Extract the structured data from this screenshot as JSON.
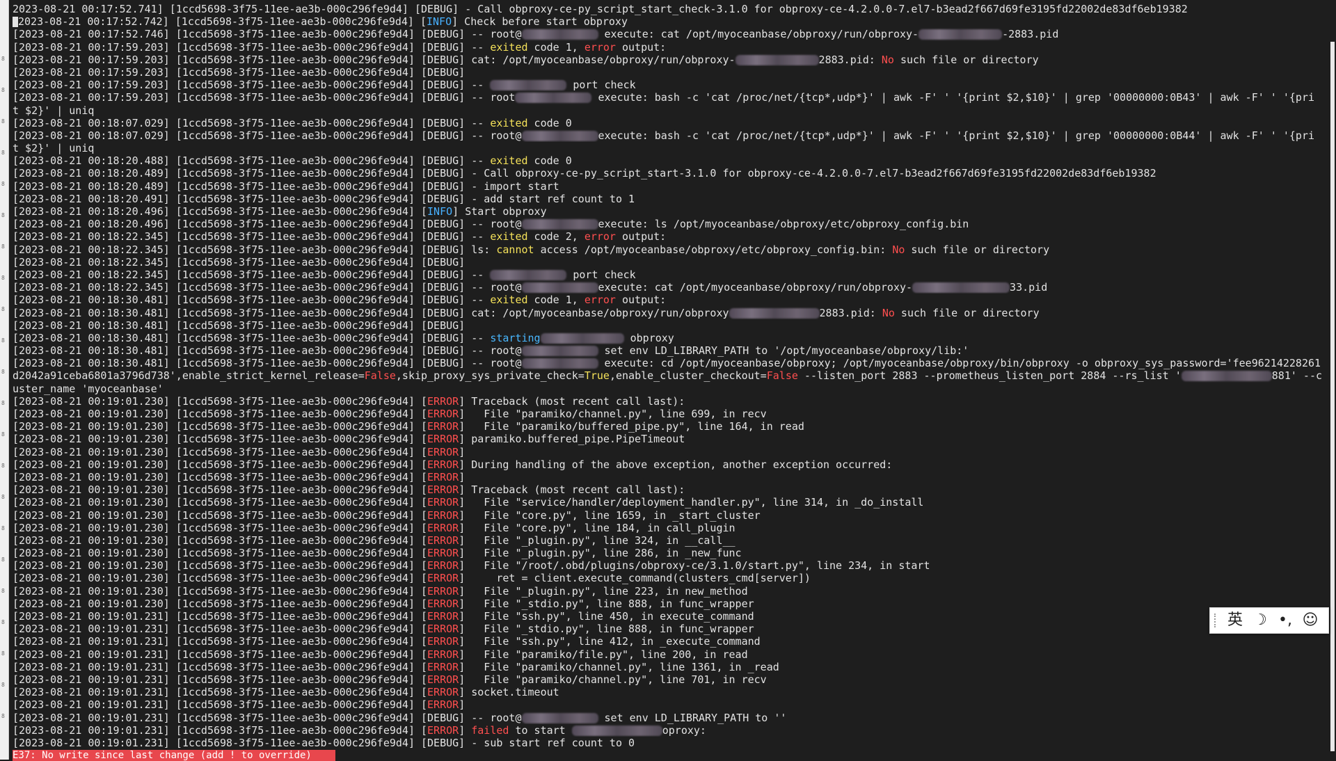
{
  "gutter": [
    "8",
    "8",
    "8",
    "8",
    "8",
    "8",
    "8",
    "8",
    "8",
    "8",
    "8",
    "8",
    "8",
    "8",
    "8",
    "8",
    "8",
    "8",
    "8",
    "8",
    "8",
    "8"
  ],
  "lines": [
    [
      [
        "2023-08-21 00:17:52.741",
        "t"
      ],
      [
        "] [",
        "t"
      ],
      [
        "1ccd5698-3f75-11ee-ae3b-000c296fe9d4",
        "t"
      ],
      [
        "] [DEBUG] - Call obproxy-ce-py_script_start_check-3.1.0 for obproxy-ce-4.2.0.0-7.el7-b3ead2f667d69fe3195fd22002de83df6eb19382",
        "t"
      ]
    ],
    [
      [
        "[2023-08-21 00:17:52.742] [1ccd5698-3f75-11ee-ae3b-000c296fe9d4] [",
        "t"
      ],
      [
        "INFO",
        "inf"
      ],
      [
        "] Check before start obproxy",
        "t"
      ]
    ],
    [
      [
        "[2023-08-21 00:17:52.746] [1ccd5698-3f75-11ee-ae3b-000c296fe9d4] [DEBUG] -- root@",
        "t"
      ],
      [
        "",
        "b",
        110
      ],
      [
        " execute: cat /opt/myoceanbase/obproxy/run/obproxy-",
        "t"
      ],
      [
        "",
        "b",
        120
      ],
      [
        "-2883.pid",
        "t"
      ]
    ],
    [
      [
        "[2023-08-21 00:17:59.203] [1ccd5698-3f75-11ee-ae3b-000c296fe9d4] [DEBUG] -- ",
        "t"
      ],
      [
        "exited",
        "kw"
      ],
      [
        " code 1, ",
        "t"
      ],
      [
        "error",
        "er"
      ],
      [
        " output:",
        "t"
      ]
    ],
    [
      [
        "[2023-08-21 00:17:59.203] [1ccd5698-3f75-11ee-ae3b-000c296fe9d4] [DEBUG] cat: /opt/myoceanbase/obproxy/run/obproxy-",
        "t"
      ],
      [
        "",
        "b",
        120
      ],
      [
        "2883.pid: ",
        "t"
      ],
      [
        "No",
        "er"
      ],
      [
        " such file or directory",
        "t"
      ]
    ],
    [
      [
        "[2023-08-21 00:17:59.203] [1ccd5698-3f75-11ee-ae3b-000c296fe9d4] [DEBUG]",
        "t"
      ]
    ],
    [
      [
        "[2023-08-21 00:17:59.203] [1ccd5698-3f75-11ee-ae3b-000c296fe9d4] [DEBUG] -- ",
        "t"
      ],
      [
        "",
        "b",
        110
      ],
      [
        " port check",
        "t"
      ]
    ],
    [
      [
        "[2023-08-21 00:17:59.203] [1ccd5698-3f75-11ee-ae3b-000c296fe9d4] [DEBUG] -- root",
        "t"
      ],
      [
        "",
        "b",
        110
      ],
      [
        " execute: bash -c 'cat /proc/net/{tcp*,udp*}' | awk -F' ' '{print $2,$10}' | grep '00000000:0B43' | awk -F' ' '{pri",
        "t"
      ]
    ],
    [
      [
        "t $2}' | uniq",
        "t"
      ]
    ],
    [
      [
        "[2023-08-21 00:18:07.029] [1ccd5698-3f75-11ee-ae3b-000c296fe9d4] [DEBUG] -- ",
        "t"
      ],
      [
        "exited",
        "kw"
      ],
      [
        " code 0",
        "t"
      ]
    ],
    [
      [
        "[2023-08-21 00:18:07.029] [1ccd5698-3f75-11ee-ae3b-000c296fe9d4] [DEBUG] -- root@",
        "t"
      ],
      [
        "",
        "b",
        110
      ],
      [
        "execute: bash -c 'cat /proc/net/{tcp*,udp*}' | awk -F' ' '{print $2,$10}' | grep '00000000:0B44' | awk -F' ' '{pri",
        "t"
      ]
    ],
    [
      [
        "t $2}' | uniq",
        "t"
      ]
    ],
    [
      [
        "[2023-08-21 00:18:20.488] [1ccd5698-3f75-11ee-ae3b-000c296fe9d4] [DEBUG] -- ",
        "t"
      ],
      [
        "exited",
        "kw"
      ],
      [
        " code 0",
        "t"
      ]
    ],
    [
      [
        "[2023-08-21 00:18:20.489] [1ccd5698-3f75-11ee-ae3b-000c296fe9d4] [DEBUG] - Call obproxy-ce-py_script_start-3.1.0 for obproxy-ce-4.2.0.0-7.el7-b3ead2f667d69fe3195fd22002de83df6eb19382",
        "t"
      ]
    ],
    [
      [
        "[2023-08-21 00:18:20.489] [1ccd5698-3f75-11ee-ae3b-000c296fe9d4] [DEBUG] - import start",
        "t"
      ]
    ],
    [
      [
        "[2023-08-21 00:18:20.491] [1ccd5698-3f75-11ee-ae3b-000c296fe9d4] [DEBUG] - add start ref count to 1",
        "t"
      ]
    ],
    [
      [
        "[2023-08-21 00:18:20.496] [1ccd5698-3f75-11ee-ae3b-000c296fe9d4] [",
        "t"
      ],
      [
        "INFO",
        "inf"
      ],
      [
        "] Start obproxy",
        "t"
      ]
    ],
    [
      [
        "[2023-08-21 00:18:20.496] [1ccd5698-3f75-11ee-ae3b-000c296fe9d4] [DEBUG] -- root@",
        "t"
      ],
      [
        "",
        "b",
        110
      ],
      [
        "execute: ls /opt/myoceanbase/obproxy/etc/obproxy_config.bin",
        "t"
      ]
    ],
    [
      [
        "[2023-08-21 00:18:22.345] [1ccd5698-3f75-11ee-ae3b-000c296fe9d4] [DEBUG] -- ",
        "t"
      ],
      [
        "exited",
        "kw"
      ],
      [
        " code 2, ",
        "t"
      ],
      [
        "error",
        "er"
      ],
      [
        " output:",
        "t"
      ]
    ],
    [
      [
        "[2023-08-21 00:18:22.345] [1ccd5698-3f75-11ee-ae3b-000c296fe9d4] [DEBUG] ls: ",
        "t"
      ],
      [
        "cannot",
        "kw"
      ],
      [
        " access /opt/myoceanbase/obproxy/etc/obproxy_config.bin: ",
        "t"
      ],
      [
        "No",
        "er"
      ],
      [
        " such file or directory",
        "t"
      ]
    ],
    [
      [
        "[2023-08-21 00:18:22.345] [1ccd5698-3f75-11ee-ae3b-000c296fe9d4] [DEBUG]",
        "t"
      ]
    ],
    [
      [
        "[2023-08-21 00:18:22.345] [1ccd5698-3f75-11ee-ae3b-000c296fe9d4] [DEBUG] -- ",
        "t"
      ],
      [
        "",
        "b",
        110
      ],
      [
        " port check",
        "t"
      ]
    ],
    [
      [
        "[2023-08-21 00:18:22.345] [1ccd5698-3f75-11ee-ae3b-000c296fe9d4] [DEBUG] -- root@",
        "t"
      ],
      [
        "",
        "b",
        110
      ],
      [
        "execute: cat /opt/myoceanbase/obproxy/run/obproxy-",
        "t"
      ],
      [
        "",
        "b",
        140
      ],
      [
        "33.pid",
        "t"
      ]
    ],
    [
      [
        "[2023-08-21 00:18:30.481] [1ccd5698-3f75-11ee-ae3b-000c296fe9d4] [DEBUG] -- ",
        "t"
      ],
      [
        "exited",
        "kw"
      ],
      [
        " code 1, ",
        "t"
      ],
      [
        "error",
        "er"
      ],
      [
        " output:",
        "t"
      ]
    ],
    [
      [
        "[2023-08-21 00:18:30.481] [1ccd5698-3f75-11ee-ae3b-000c296fe9d4] [DEBUG] cat: /opt/myoceanbase/obproxy/run/obproxy",
        "t"
      ],
      [
        "",
        "b",
        130
      ],
      [
        "2883.pid: ",
        "t"
      ],
      [
        "No",
        "er"
      ],
      [
        " such file or directory",
        "t"
      ]
    ],
    [
      [
        "[2023-08-21 00:18:30.481] [1ccd5698-3f75-11ee-ae3b-000c296fe9d4] [DEBUG]",
        "t"
      ]
    ],
    [
      [
        "[2023-08-21 00:18:30.481] [1ccd5698-3f75-11ee-ae3b-000c296fe9d4] [DEBUG] -- ",
        "t"
      ],
      [
        "starting",
        "st"
      ],
      [
        "",
        "b",
        120
      ],
      [
        " obproxy",
        "t"
      ]
    ],
    [
      [
        "[2023-08-21 00:18:30.481] [1ccd5698-3f75-11ee-ae3b-000c296fe9d4] [DEBUG] -- root@",
        "t"
      ],
      [
        "",
        "b",
        110
      ],
      [
        " set env LD_LIBRARY_PATH to '/opt/myoceanbase/obproxy/lib:'",
        "t"
      ]
    ],
    [
      [
        "[2023-08-21 00:18:30.481] [1ccd5698-3f75-11ee-ae3b-000c296fe9d4] [DEBUG] -- root@",
        "t"
      ],
      [
        "",
        "b",
        110
      ],
      [
        " execute: cd /opt/myoceanbase/obproxy; /opt/myoceanbase/obproxy/bin/obproxy -o obproxy_sys_password='fee96214228261",
        "t"
      ]
    ],
    [
      [
        "d2042a91ceba6801a3796d738',enable_strict_kernel_release=",
        "t"
      ],
      [
        "False",
        "er"
      ],
      [
        ",skip_proxy_sys_private_check=",
        "t"
      ],
      [
        "True",
        "kw"
      ],
      [
        ",enable_cluster_checkout=",
        "t"
      ],
      [
        "False",
        "er"
      ],
      [
        " --listen_port 2883 --prometheus_listen_port 2884 --rs_list '",
        "t"
      ],
      [
        "",
        "b",
        130
      ],
      [
        "881' --c",
        "t"
      ]
    ],
    [
      [
        "uster_name 'myoceanbase'",
        "t"
      ]
    ],
    [
      [
        "[2023-08-21 00:19:01.230] [1ccd5698-3f75-11ee-ae3b-000c296fe9d4] [",
        "t"
      ],
      [
        "ERROR",
        "er"
      ],
      [
        "] Traceback (most recent call last):",
        "t"
      ]
    ],
    [
      [
        "[2023-08-21 00:19:01.230] [1ccd5698-3f75-11ee-ae3b-000c296fe9d4] [",
        "t"
      ],
      [
        "ERROR",
        "er"
      ],
      [
        "]   File \"paramiko/channel.py\", line 699, in recv",
        "t"
      ]
    ],
    [
      [
        "[2023-08-21 00:19:01.230] [1ccd5698-3f75-11ee-ae3b-000c296fe9d4] [",
        "t"
      ],
      [
        "ERROR",
        "er"
      ],
      [
        "]   File \"paramiko/buffered_pipe.py\", line 164, in read",
        "t"
      ]
    ],
    [
      [
        "[2023-08-21 00:19:01.230] [1ccd5698-3f75-11ee-ae3b-000c296fe9d4] [",
        "t"
      ],
      [
        "ERROR",
        "er"
      ],
      [
        "] paramiko.buffered_pipe.PipeTimeout",
        "t"
      ]
    ],
    [
      [
        "[2023-08-21 00:19:01.230] [1ccd5698-3f75-11ee-ae3b-000c296fe9d4] [",
        "t"
      ],
      [
        "ERROR",
        "er"
      ],
      [
        "]",
        "t"
      ]
    ],
    [
      [
        "[2023-08-21 00:19:01.230] [1ccd5698-3f75-11ee-ae3b-000c296fe9d4] [",
        "t"
      ],
      [
        "ERROR",
        "er"
      ],
      [
        "] During handling of the above exception, another exception occurred:",
        "t"
      ]
    ],
    [
      [
        "[2023-08-21 00:19:01.230] [1ccd5698-3f75-11ee-ae3b-000c296fe9d4] [",
        "t"
      ],
      [
        "ERROR",
        "er"
      ],
      [
        "]",
        "t"
      ]
    ],
    [
      [
        "[2023-08-21 00:19:01.230] [1ccd5698-3f75-11ee-ae3b-000c296fe9d4] [",
        "t"
      ],
      [
        "ERROR",
        "er"
      ],
      [
        "] Traceback (most recent call last):",
        "t"
      ]
    ],
    [
      [
        "[2023-08-21 00:19:01.230] [1ccd5698-3f75-11ee-ae3b-000c296fe9d4] [",
        "t"
      ],
      [
        "ERROR",
        "er"
      ],
      [
        "]   File \"service/handler/deployment_handler.py\", line 314, in _do_install",
        "t"
      ]
    ],
    [
      [
        "[2023-08-21 00:19:01.230] [1ccd5698-3f75-11ee-ae3b-000c296fe9d4] [",
        "t"
      ],
      [
        "ERROR",
        "er"
      ],
      [
        "]   File \"core.py\", line 1659, in _start_cluster",
        "t"
      ]
    ],
    [
      [
        "[2023-08-21 00:19:01.230] [1ccd5698-3f75-11ee-ae3b-000c296fe9d4] [",
        "t"
      ],
      [
        "ERROR",
        "er"
      ],
      [
        "]   File \"core.py\", line 184, in call_plugin",
        "t"
      ]
    ],
    [
      [
        "[2023-08-21 00:19:01.230] [1ccd5698-3f75-11ee-ae3b-000c296fe9d4] [",
        "t"
      ],
      [
        "ERROR",
        "er"
      ],
      [
        "]   File \"_plugin.py\", line 324, in __call__",
        "t"
      ]
    ],
    [
      [
        "[2023-08-21 00:19:01.230] [1ccd5698-3f75-11ee-ae3b-000c296fe9d4] [",
        "t"
      ],
      [
        "ERROR",
        "er"
      ],
      [
        "]   File \"_plugin.py\", line 286, in _new_func",
        "t"
      ]
    ],
    [
      [
        "[2023-08-21 00:19:01.230] [1ccd5698-3f75-11ee-ae3b-000c296fe9d4] [",
        "t"
      ],
      [
        "ERROR",
        "er"
      ],
      [
        "]   File \"/root/.obd/plugins/obproxy-ce/3.1.0/start.py\", line 234, in start",
        "t"
      ]
    ],
    [
      [
        "[2023-08-21 00:19:01.230] [1ccd5698-3f75-11ee-ae3b-000c296fe9d4] [",
        "t"
      ],
      [
        "ERROR",
        "er"
      ],
      [
        "]     ret = client.execute_command(clusters_cmd[server])",
        "t"
      ]
    ],
    [
      [
        "[2023-08-21 00:19:01.230] [1ccd5698-3f75-11ee-ae3b-000c296fe9d4] [",
        "t"
      ],
      [
        "ERROR",
        "er"
      ],
      [
        "]   File \"_plugin.py\", line 223, in new_method",
        "t"
      ]
    ],
    [
      [
        "[2023-08-21 00:19:01.230] [1ccd5698-3f75-11ee-ae3b-000c296fe9d4] [",
        "t"
      ],
      [
        "ERROR",
        "er"
      ],
      [
        "]   File \"_stdio.py\", line 888, in func_wrapper",
        "t"
      ]
    ],
    [
      [
        "[2023-08-21 00:19:01.231] [1ccd5698-3f75-11ee-ae3b-000c296fe9d4] [",
        "t"
      ],
      [
        "ERROR",
        "er"
      ],
      [
        "]   File \"ssh.py\", line 450, in execute_command",
        "t"
      ]
    ],
    [
      [
        "[2023-08-21 00:19:01.231] [1ccd5698-3f75-11ee-ae3b-000c296fe9d4] [",
        "t"
      ],
      [
        "ERROR",
        "er"
      ],
      [
        "]   File \"_stdio.py\", line 888, in func_wrapper",
        "t"
      ]
    ],
    [
      [
        "[2023-08-21 00:19:01.231] [1ccd5698-3f75-11ee-ae3b-000c296fe9d4] [",
        "t"
      ],
      [
        "ERROR",
        "er"
      ],
      [
        "]   File \"ssh.py\", line 412, in _execute_command",
        "t"
      ]
    ],
    [
      [
        "[2023-08-21 00:19:01.231] [1ccd5698-3f75-11ee-ae3b-000c296fe9d4] [",
        "t"
      ],
      [
        "ERROR",
        "er"
      ],
      [
        "]   File \"paramiko/file.py\", line 200, in read",
        "t"
      ]
    ],
    [
      [
        "[2023-08-21 00:19:01.231] [1ccd5698-3f75-11ee-ae3b-000c296fe9d4] [",
        "t"
      ],
      [
        "ERROR",
        "er"
      ],
      [
        "]   File \"paramiko/channel.py\", line 1361, in _read",
        "t"
      ]
    ],
    [
      [
        "[2023-08-21 00:19:01.231] [1ccd5698-3f75-11ee-ae3b-000c296fe9d4] [",
        "t"
      ],
      [
        "ERROR",
        "er"
      ],
      [
        "]   File \"paramiko/channel.py\", line 701, in recv",
        "t"
      ]
    ],
    [
      [
        "[2023-08-21 00:19:01.231] [1ccd5698-3f75-11ee-ae3b-000c296fe9d4] [",
        "t"
      ],
      [
        "ERROR",
        "er"
      ],
      [
        "] socket.timeout",
        "t"
      ]
    ],
    [
      [
        "[2023-08-21 00:19:01.231] [1ccd5698-3f75-11ee-ae3b-000c296fe9d4] [",
        "t"
      ],
      [
        "ERROR",
        "er"
      ],
      [
        "]",
        "t"
      ]
    ],
    [
      [
        "[2023-08-21 00:19:01.231] [1ccd5698-3f75-11ee-ae3b-000c296fe9d4] [DEBUG] -- root@",
        "t"
      ],
      [
        "",
        "b",
        110
      ],
      [
        " set env LD_LIBRARY_PATH to ''",
        "t"
      ]
    ],
    [
      [
        "[2023-08-21 00:19:01.231] [1ccd5698-3f75-11ee-ae3b-000c296fe9d4] [",
        "t"
      ],
      [
        "ERROR",
        "er"
      ],
      [
        "] ",
        "t"
      ],
      [
        "failed",
        "er"
      ],
      [
        " to start ",
        "t"
      ],
      [
        "",
        "b",
        130
      ],
      [
        "oproxy:",
        "t"
      ]
    ],
    [
      [
        "[2023-08-21 00:19:01.231] [1ccd5698-3f75-11ee-ae3b-000c296fe9d4] [DEBUG] - sub start ref count to 0",
        "t"
      ]
    ]
  ],
  "command_line": "E37: No write since last change (add ! to override)",
  "ime_toolbar": {
    "items": [
      {
        "label": "英",
        "icon": "lang-toggle"
      },
      {
        "label": "☽",
        "icon": "moon-icon"
      },
      {
        "label": "•,",
        "icon": "punctuation-icon"
      },
      {
        "label": "☺",
        "icon": "emoji-icon"
      }
    ]
  },
  "colors": {
    "background": "#1e1e1e",
    "keyword": "#f5e25a",
    "error": "#ff4f4f",
    "info": "#48b1ff",
    "statusbar": "#e8474d"
  }
}
